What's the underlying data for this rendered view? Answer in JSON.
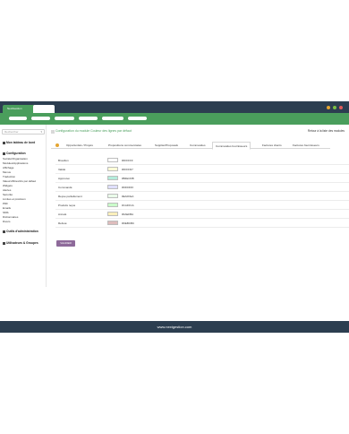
{
  "browser": {
    "tab_title": "NextGestion",
    "dot_colors": [
      "#e5a531",
      "#7ac043",
      "#e05a5a"
    ]
  },
  "header": {
    "nav_count": 6
  },
  "sidebar": {
    "search_placeholder": "Rechercher",
    "dashboard_label": "Mon tableau de bord",
    "config_label": "Configuration",
    "items": [
      "Société/Organisation",
      "Modules/Applications",
      "Affichage",
      "Menus",
      "Traduction",
      "Valeurs/filtres/tris par défaut",
      "Widgets",
      "Alertes",
      "Sécurité",
      "Limites et précision",
      "PDF",
      "Emails",
      "SMS",
      "Dictionnaires",
      "Divers"
    ],
    "admin_tools_label": "Outils d'administration",
    "users_label": "Utilisateurs & Groupes"
  },
  "main": {
    "title": "Configuration du module Couleur des lignes par défaut",
    "back_link": "Retour à la liste des modules",
    "tabs": [
      "Opportunités / Projets",
      "Propositions commerciales",
      "Supplier/Proposals",
      "Commandes",
      "Commandes fournisseurs",
      "Factures clients",
      "Factures fournisseurs"
    ],
    "active_tab": 4,
    "rows": [
      {
        "label": "Brouillon",
        "hex": "#FFFFFF",
        "color": "#FFFFFF"
      },
      {
        "label": "Validé",
        "hex": "#FFFFD7",
        "color": "#FFFFD7"
      },
      {
        "label": "Approuvé",
        "hex": "#B4ECDB",
        "color": "#B4ECDB"
      },
      {
        "label": "Commandé",
        "hex": "#DFDFFF",
        "color": "#DFDFFF"
      },
      {
        "label": "Reçue partiellement",
        "hex": "#EAFFEA",
        "color": "#EAFFEA"
      },
      {
        "label": "Produits reçus",
        "hex": "#CAFFCA",
        "color": "#CAFFCA"
      },
      {
        "label": "Annulé",
        "hex": "#FAEFBA",
        "color": "#FAEFBA"
      },
      {
        "label": "Refusé",
        "hex": "#DEBCBC",
        "color": "#DEBCBC"
      }
    ],
    "save_label": "VALIDER"
  },
  "footer": {
    "text": "www.nextgestion.com"
  }
}
